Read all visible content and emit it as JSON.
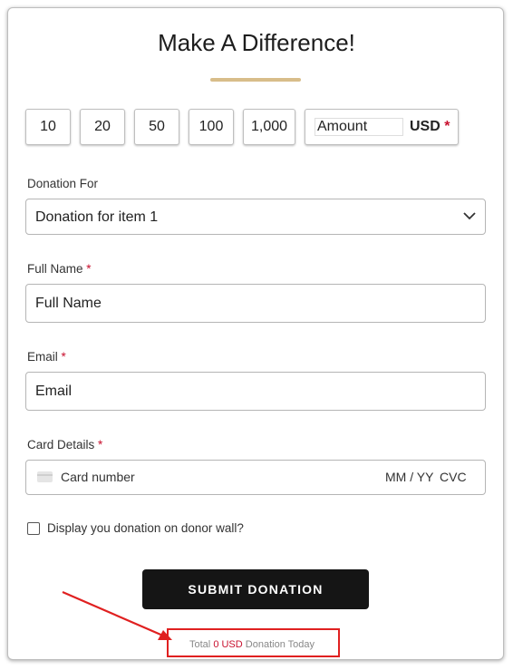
{
  "form": {
    "title": "Make A Difference!",
    "amount_options": [
      "10",
      "20",
      "50",
      "100",
      "1,000"
    ],
    "custom_amount_placeholder": "Amount",
    "currency": "USD",
    "required_mark": "*",
    "donation_for": {
      "label": "Donation For",
      "selected": "Donation for item 1"
    },
    "full_name": {
      "label": "Full Name",
      "placeholder": "Full Name"
    },
    "email": {
      "label": "Email",
      "placeholder": "Email"
    },
    "card_details": {
      "label": "Card Details",
      "number_placeholder": "Card number",
      "expiry_placeholder": "MM / YY",
      "cvc_placeholder": "CVC"
    },
    "donor_wall_label": "Display you donation on donor wall?",
    "submit_label": "SUBMIT DONATION",
    "total": {
      "prefix": "Total",
      "amount": "0 USD",
      "suffix": "Donation Today"
    }
  },
  "colors": {
    "accent_rule": "#d8bd8a",
    "required": "#c8102e",
    "button_bg": "#151515",
    "annotation": "#e02020"
  },
  "icons": {
    "dropdown": "chevron-down-icon",
    "card": "credit-card-icon",
    "annotation": "red-arrow-icon"
  }
}
